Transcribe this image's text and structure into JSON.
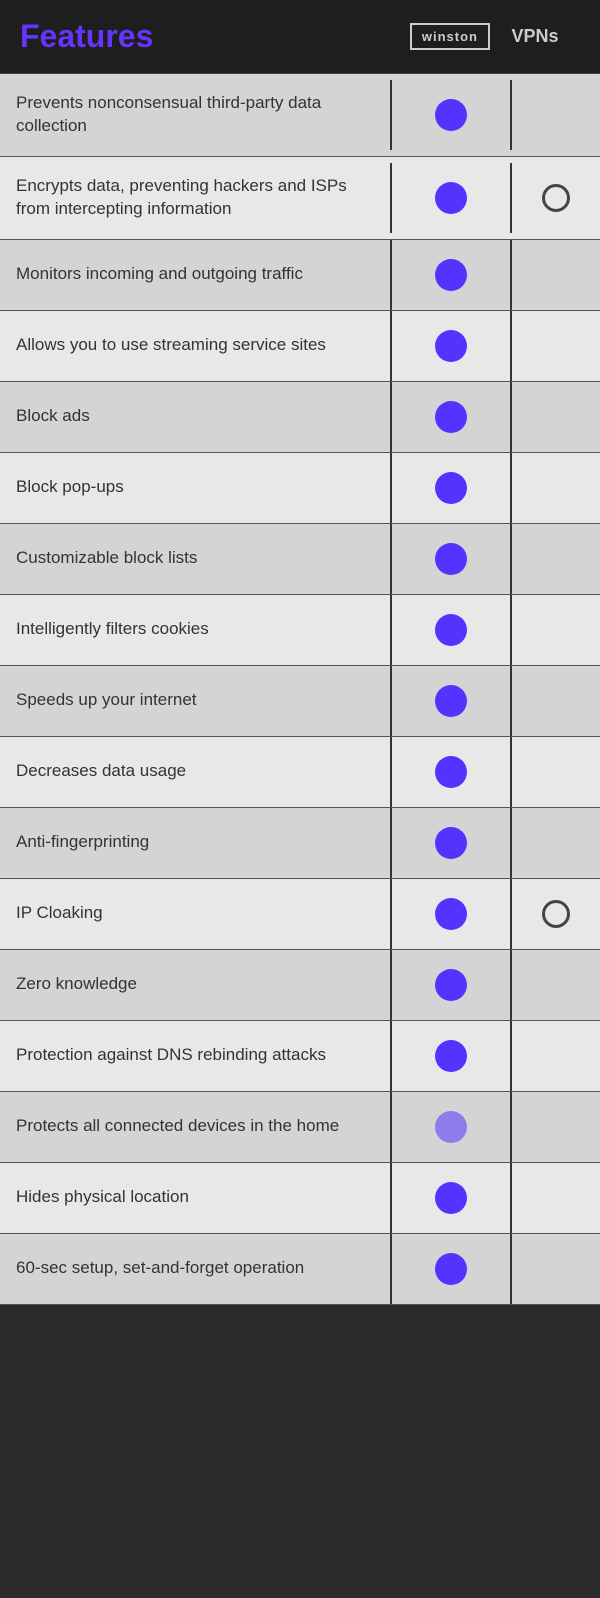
{
  "header": {
    "title": "Features",
    "winston_label": "winston",
    "vpns_label": "VPNs"
  },
  "rows": [
    {
      "id": "row-nonconsensual",
      "label": "Prevents nonconsensual third-party data collection",
      "winston": "filled",
      "vpns": "none"
    },
    {
      "id": "row-encrypts",
      "label": "Encrypts data, preventing hackers and ISPs from intercepting information",
      "winston": "filled",
      "vpns": "outline"
    },
    {
      "id": "row-monitors",
      "label": "Monitors incoming and outgoing traffic",
      "winston": "filled",
      "vpns": "none"
    },
    {
      "id": "row-streaming",
      "label": "Allows you to use streaming service sites",
      "winston": "filled",
      "vpns": "none"
    },
    {
      "id": "row-block-ads",
      "label": "Block ads",
      "winston": "filled",
      "vpns": "none"
    },
    {
      "id": "row-block-popups",
      "label": "Block pop-ups",
      "winston": "filled",
      "vpns": "none"
    },
    {
      "id": "row-block-lists",
      "label": "Customizable block lists",
      "winston": "filled",
      "vpns": "none"
    },
    {
      "id": "row-cookies",
      "label": "Intelligently filters cookies",
      "winston": "filled",
      "vpns": "none"
    },
    {
      "id": "row-speeds-up",
      "label": "Speeds up your internet",
      "winston": "filled",
      "vpns": "none"
    },
    {
      "id": "row-data-usage",
      "label": "Decreases data usage",
      "winston": "filled",
      "vpns": "none"
    },
    {
      "id": "row-fingerprinting",
      "label": "Anti-fingerprinting",
      "winston": "filled",
      "vpns": "none"
    },
    {
      "id": "row-ip-cloaking",
      "label": "IP Cloaking",
      "winston": "filled",
      "vpns": "outline"
    },
    {
      "id": "row-zero-knowledge",
      "label": "Zero knowledge",
      "winston": "filled",
      "vpns": "none"
    },
    {
      "id": "row-dns-rebinding",
      "label": "Protection against DNS rebinding attacks",
      "winston": "filled",
      "vpns": "none"
    },
    {
      "id": "row-home-devices",
      "label": "Protects all connected devices in the home",
      "winston": "half",
      "vpns": "none"
    },
    {
      "id": "row-location",
      "label": "Hides physical location",
      "winston": "filled",
      "vpns": "none"
    },
    {
      "id": "row-setup",
      "label": "60-sec setup, set-and-forget operation",
      "winston": "filled",
      "vpns": "none"
    }
  ]
}
